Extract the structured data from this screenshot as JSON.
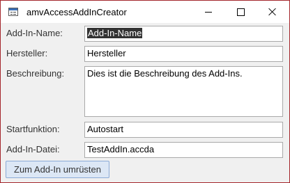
{
  "window": {
    "title": "amvAccessAddInCreator"
  },
  "form": {
    "addin_name": {
      "label": "Add-In-Name:",
      "value": "Add-In-Name"
    },
    "hersteller": {
      "label": "Hersteller:",
      "value": "Hersteller"
    },
    "beschreibung": {
      "label": "Beschreibung:",
      "value": "Dies ist die Beschreibung des Add-Ins."
    },
    "startfunktion": {
      "label": "Startfunktion:",
      "value": "Autostart"
    },
    "addin_datei": {
      "label": "Add-In-Datei:",
      "value": "TestAddIn.accda"
    },
    "convert_button": {
      "label": "Zum Add-In umrüsten"
    }
  },
  "colors": {
    "window_border": "#a4262c",
    "form_background": "#f0f0f0",
    "selection_background": "#333333",
    "button_background": "#dce7f5",
    "button_border": "#8aaad6"
  },
  "icons": {
    "app": "access-form-icon",
    "minimize": "minimize-icon",
    "maximize": "maximize-icon",
    "close": "close-icon"
  }
}
